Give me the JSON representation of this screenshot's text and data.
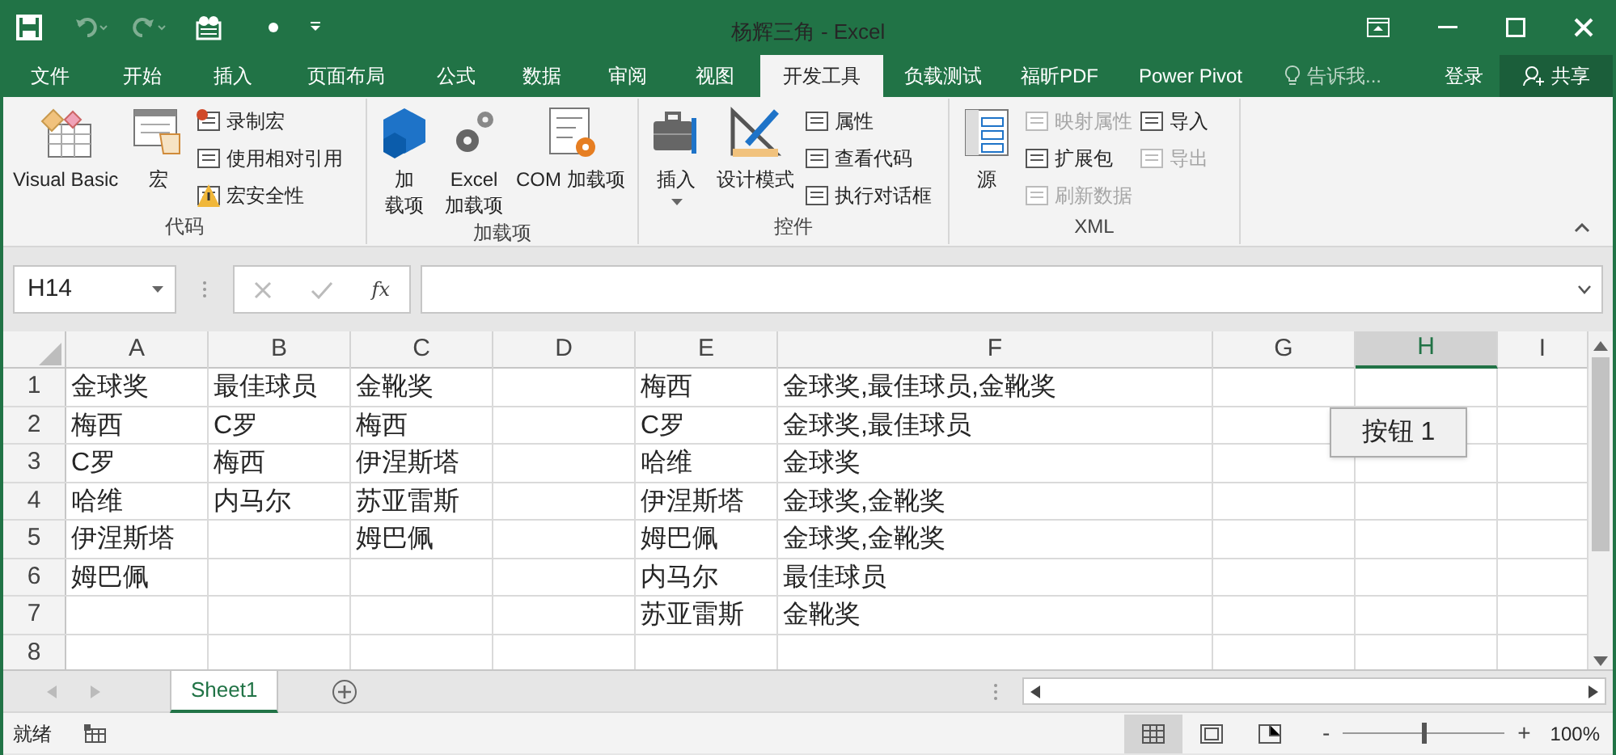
{
  "window": {
    "title": "杨辉三角 - Excel"
  },
  "ribbon_tabs": [
    {
      "label": "文件",
      "selected": false
    },
    {
      "label": "开始",
      "selected": false
    },
    {
      "label": "插入",
      "selected": false
    },
    {
      "label": "页面布局",
      "selected": false
    },
    {
      "label": "公式",
      "selected": false
    },
    {
      "label": "数据",
      "selected": false
    },
    {
      "label": "审阅",
      "selected": false
    },
    {
      "label": "视图",
      "selected": false
    },
    {
      "label": "开发工具",
      "selected": true
    },
    {
      "label": "负载测试",
      "selected": false
    },
    {
      "label": "福昕PDF",
      "selected": false
    },
    {
      "label": "Power Pivot",
      "selected": false
    }
  ],
  "tell_me": {
    "placeholder": "告诉我..."
  },
  "sign_in": "登录",
  "share": "共享",
  "ribbon_groups": [
    {
      "title": "代码",
      "items": [
        {
          "kind": "large",
          "lines": [
            "Visual Basic"
          ]
        },
        {
          "kind": "large",
          "lines": [
            "宏"
          ]
        },
        {
          "kind": "stack",
          "items": [
            {
              "label": "录制宏",
              "disabled": false
            },
            {
              "label": "使用相对引用",
              "disabled": false
            },
            {
              "label": "宏安全性",
              "disabled": false
            }
          ]
        }
      ]
    },
    {
      "title": "加载项",
      "items": [
        {
          "kind": "large",
          "lines": [
            "加",
            "载项"
          ]
        },
        {
          "kind": "large",
          "lines": [
            "Excel",
            "加载项"
          ]
        },
        {
          "kind": "large",
          "lines": [
            "COM 加载项"
          ]
        }
      ]
    },
    {
      "title": "控件",
      "items": [
        {
          "kind": "dropdown",
          "lines": [
            "插入"
          ]
        },
        {
          "kind": "large",
          "lines": [
            "设计模式"
          ]
        },
        {
          "kind": "stack",
          "items": [
            {
              "label": "属性",
              "disabled": false
            },
            {
              "label": "查看代码",
              "disabled": false
            },
            {
              "label": "执行对话框",
              "disabled": false
            }
          ]
        }
      ]
    },
    {
      "title": "XML",
      "items": [
        {
          "kind": "large",
          "lines": [
            "源"
          ]
        },
        {
          "kind": "stack",
          "items": [
            {
              "label": "映射属性",
              "disabled": true
            },
            {
              "label": "扩展包",
              "disabled": false
            },
            {
              "label": "刷新数据",
              "disabled": true
            }
          ]
        },
        {
          "kind": "stack",
          "items": [
            {
              "label": "导入",
              "disabled": false
            },
            {
              "label": "导出",
              "disabled": true
            }
          ]
        }
      ]
    }
  ],
  "name_box": "H14",
  "function_label": "fx",
  "columns": [
    {
      "label": "A",
      "selected": false
    },
    {
      "label": "B",
      "selected": false
    },
    {
      "label": "C",
      "selected": false
    },
    {
      "label": "D",
      "selected": false
    },
    {
      "label": "E",
      "selected": false
    },
    {
      "label": "F",
      "selected": false
    },
    {
      "label": "G",
      "selected": false
    },
    {
      "label": "H",
      "selected": true
    },
    {
      "label": "I",
      "selected": false
    }
  ],
  "rows": [
    {
      "label": "1",
      "cells": {
        "a": "金球奖",
        "b": "最佳球员",
        "c": "金靴奖",
        "e": "梅西",
        "f": "金球奖,最佳球员,金靴奖"
      }
    },
    {
      "label": "2",
      "cells": {
        "a": "梅西",
        "b": "C罗",
        "c": "梅西",
        "e": "C罗",
        "f": "金球奖,最佳球员"
      }
    },
    {
      "label": "3",
      "cells": {
        "a": "C罗",
        "b": "梅西",
        "c": "伊涅斯塔",
        "e": "哈维",
        "f": "金球奖"
      }
    },
    {
      "label": "4",
      "cells": {
        "a": "哈维",
        "b": "内马尔",
        "c": "苏亚雷斯",
        "e": "伊涅斯塔",
        "f": "金球奖,金靴奖"
      }
    },
    {
      "label": "5",
      "cells": {
        "a": "伊涅斯塔",
        "c": "姆巴佩",
        "e": "姆巴佩",
        "f": "金球奖,金靴奖"
      }
    },
    {
      "label": "6",
      "cells": {
        "a": "姆巴佩",
        "e": "内马尔",
        "f": "最佳球员"
      }
    },
    {
      "label": "7",
      "cells": {
        "e": "苏亚雷斯",
        "f": "金靴奖"
      }
    },
    {
      "label": "8",
      "cells": {}
    }
  ],
  "form_button": {
    "label": "按钮 1"
  },
  "sheet_tabs": [
    {
      "label": "Sheet1",
      "selected": true
    }
  ],
  "status_bar": {
    "text": "就绪",
    "views": [
      {
        "kind": "normal",
        "selected": true
      },
      {
        "kind": "page_layout",
        "selected": false
      },
      {
        "kind": "page_break",
        "selected": false
      }
    ],
    "zoom_out": "-",
    "zoom_slider": {
      "level": 0.5
    },
    "zoom_in": "+",
    "zoom": "100%"
  }
}
